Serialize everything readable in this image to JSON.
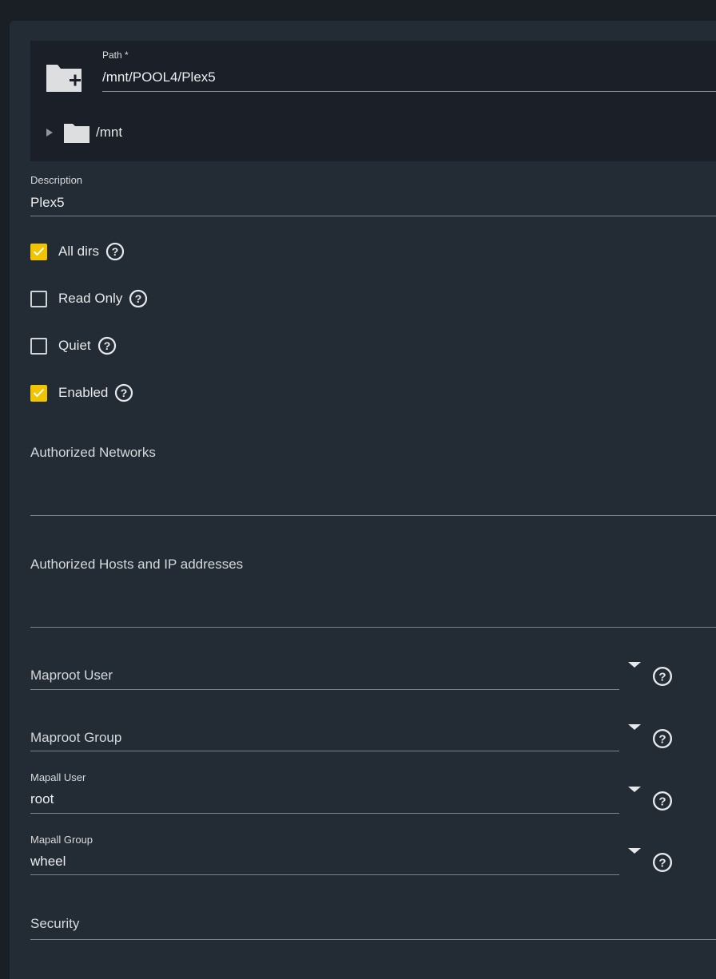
{
  "path": {
    "label": "Path *",
    "value": "/mnt/POOL4/Plex5",
    "tree_root": "/mnt"
  },
  "description": {
    "label": "Description",
    "value": "Plex5"
  },
  "checkboxes": [
    {
      "label": "All dirs",
      "checked": true
    },
    {
      "label": "Read Only",
      "checked": false
    },
    {
      "label": "Quiet",
      "checked": false
    },
    {
      "label": "Enabled",
      "checked": true
    }
  ],
  "authorized_networks": {
    "label": "Authorized Networks"
  },
  "authorized_hosts": {
    "label": "Authorized Hosts and IP addresses"
  },
  "maproot_user": {
    "label": "Maproot User"
  },
  "maproot_group": {
    "label": "Maproot Group"
  },
  "mapall_user": {
    "label": "Mapall User",
    "value": "root"
  },
  "mapall_group": {
    "label": "Mapall Group",
    "value": "wheel"
  },
  "security": {
    "label": "Security"
  },
  "colors": {
    "accent": "#f0c400",
    "panel": "#232b34",
    "explorer": "#1b2028"
  },
  "icons": [
    "folder-add-icon",
    "folder-icon",
    "expand-arrow-icon",
    "help-icon",
    "dropdown-caret-icon",
    "checkmark-icon"
  ]
}
